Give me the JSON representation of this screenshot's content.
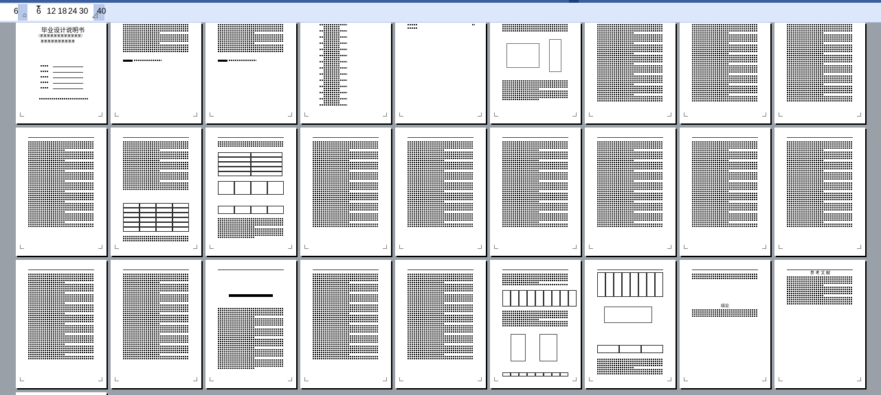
{
  "ruler": {
    "values": [
      "6",
      "6",
      "12",
      "18",
      "24",
      "30",
      "40"
    ]
  },
  "pages": {
    "cover_title": "毕业设计说明书",
    "cover_subtitle_1": "（某某某某某某某某某某某某）",
    "cover_subtitle_2": "某某某某某某某某某某",
    "p26_heading": "结论",
    "p27_heading": "参 考 文 献"
  },
  "colors": {
    "workspace": "#9aa0a8",
    "ruler_bg": "#dde7fb",
    "selection": "#b7c8e8",
    "page": "#ffffff"
  }
}
